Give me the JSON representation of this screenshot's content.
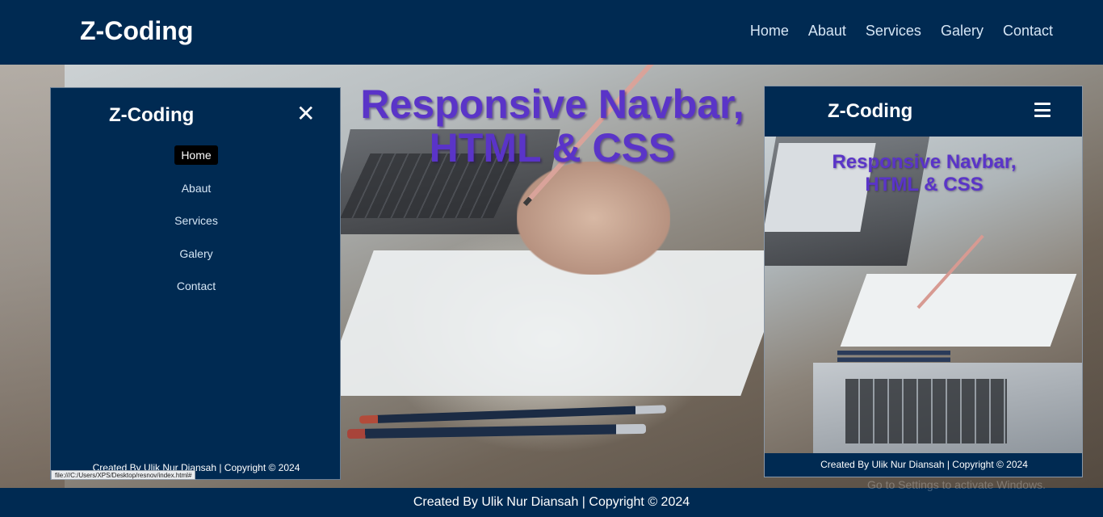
{
  "topbar": {
    "brand": "Z-Coding",
    "nav": [
      "Home",
      "Abaut",
      "Services",
      "Galery",
      "Contact"
    ]
  },
  "hero": {
    "title_line1": "Responsive Navbar,",
    "title_line2": "HTML & CSS"
  },
  "mobile_menu_open": {
    "brand": "Z-Coding",
    "close_glyph": "✕",
    "items": [
      "Home",
      "Abaut",
      "Services",
      "Galery",
      "Contact"
    ],
    "active_item": "Home",
    "footer": "Created By Ulik Nur Diansah | Copyright © 2024"
  },
  "browser_status_url": "file:///C:/Users/XPS/Desktop/resnov/index.html#",
  "mobile_menu_closed": {
    "brand": "Z-Coding",
    "title_line1": "Responsive Navbar,",
    "title_line2": "HTML & CSS",
    "footer": "Created By Ulik Nur Diansah | Copyright © 2024"
  },
  "footer": {
    "text": "Created By Ulik Nur Diansah | Copyright © 2024"
  },
  "os_watermark": "Go to Settings to activate Windows.",
  "colors": {
    "navy": "#002a52",
    "title_purple": "#5a34c8",
    "nav_link": "#d6e6f5",
    "active_bg": "#000000"
  },
  "icons": [
    "close-icon",
    "hamburger-menu-icon"
  ]
}
